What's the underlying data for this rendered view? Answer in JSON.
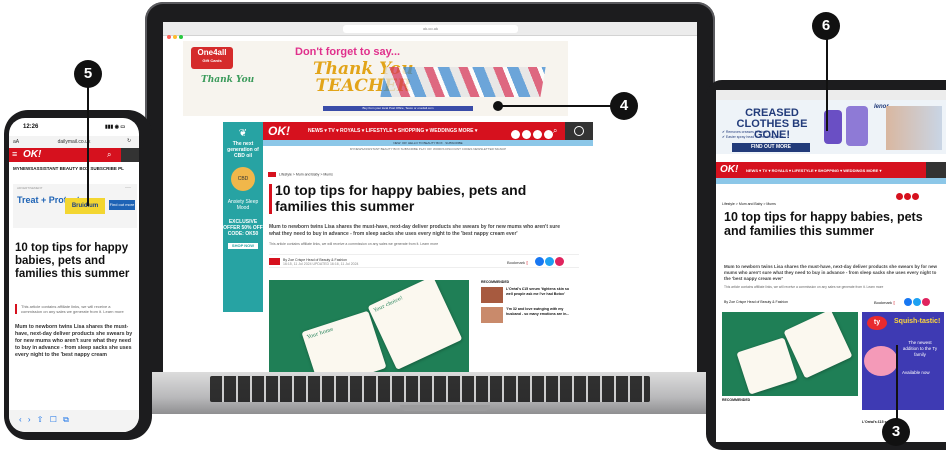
{
  "callouts": {
    "n3": "3",
    "n4": "4",
    "n5": "5",
    "n6": "6"
  },
  "laptop": {
    "url": "ok.co.uk",
    "ad_top": {
      "brand": "One4all",
      "brand_sub": "Gift Cards",
      "headline": "Don't forget to say...",
      "thank_you": "Thank You",
      "teacher": "TEACHER",
      "thank_you_small": "Thank You",
      "strip": "Buy from your local Post Office, Tesco or one4all.com"
    },
    "side_ad": {
      "headline": "The next generation of CBD oil",
      "badge": "CBD",
      "body": "Anxiety Sleep Mood",
      "offer": "EXCLUSIVE OFFER 50% OFF CODE: OK50",
      "cta": "SHOP NOW"
    },
    "nav": {
      "logo": "OK!",
      "items": "NEWS ▾   TV ▾   ROYALS ▾   LIFESTYLE ▾   SHOPPING ▾   WEDDINGS   MORE ▾"
    },
    "sub1": "NEW: OK! HELLO TO BEAUTY BOX · SUBSCRIBE",
    "sub2": "MYNEWSASSISTANT   BEAUTY BOX   SUBSCRIBE   PLAY OK! WORDS   DISCOUNT CODES   NEWSLETTER SIGNUP",
    "crumb": "Lifestyle  >  Mum and Baby  >  Mums",
    "title": "10 top tips for happy babies, pets and families this summer",
    "standfirst": "Mum to newborn twins Lisa shares the must-have, next-day deliver products she swears by for new mums who aren't sure what they need to buy in advance - from sleep sacks she uses every night to the 'best nappy cream ever'",
    "affiliate": "This article contains affiliate links, we will receive a commission on any sales we generate from it. Learn more",
    "byline": "By Zoe Crispe  Head of Beauty & Fashion",
    "dates": "16:15, 11 Jul 2024     UPDATED 16:16, 11 Jul 2024",
    "bookmark": "Bookmark",
    "img_card1": "Your home",
    "img_card2": "Your choice!",
    "recommended": "RECOMMENDED",
    "reco1": "L'Oréal's £15 serum 'tightens skin so well people ask me I've had Botox'",
    "reco2": "'I'm 32 and love swinging with my husband - so many emotions are in..."
  },
  "phone": {
    "time": "12:26",
    "url": "dailymail.co.uk",
    "logo": "OK!",
    "nav": "MYNEWSASSISTANT   BEAUTY BOX   SUBSCRIBE   PL",
    "ad_label": "ADVERTISEMENT",
    "ad_treat": "Treat + Protect.",
    "ad_brand": "Bruidium",
    "ad_cta": "Find out more",
    "title": "10 top tips for happy babies, pets and families this summer",
    "affiliate": "This article contains affiliate links, we will receive a commission on any sales we generate from it. Learn more",
    "body": "Mum to newborn twins Lisa shares the must-have, next-day deliver products she swears by for new mums who aren't sure what they need to buy in advance - from sleep sacks she uses every night to the 'best nappy cream",
    "bottom": "‹     ›     ⇧     ☐     ⧉"
  },
  "tablet": {
    "ad": {
      "headline": "CREASED CLOTHES BE GONE!",
      "c1": "✔ Removes creases in fabric",
      "c2": "✔ Easier spray head   ✔ Great fragrance",
      "cta": "FIND OUT MORE",
      "brand": "lenor"
    },
    "logo": "OK!",
    "nav": "NEWS ▾   TV ▾   ROYALS ▾   LIFESTYLE ▾   SHOPPING ▾   WEDDINGS   MORE ▾",
    "crumb": "Lifestyle  >  Mum and Baby  >  Mums",
    "title": "10 top tips for happy babies, pets and families this summer",
    "body": "Mum to newborn twins Lisa shares the must-have, next-day deliver products she swears by for new mums who aren't sure what they need to buy in advance - from sleep sacks she uses every night to the 'best nappy cream ever'",
    "affiliate": "This article contains affiliate links, we will receive a commission on any sales we generate from it. Learn more",
    "byline": "By Zoe Crispe  Head of Beauty & Fashion",
    "bookmark": "Bookmark",
    "ty": {
      "logo": "ty",
      "headline": "Squish-tastic!",
      "text": "The newest addition to the Ty family",
      "avail": "Available now"
    },
    "recommended": "RECOMMENDED",
    "reco": "L'Oréal's £15 serum"
  }
}
